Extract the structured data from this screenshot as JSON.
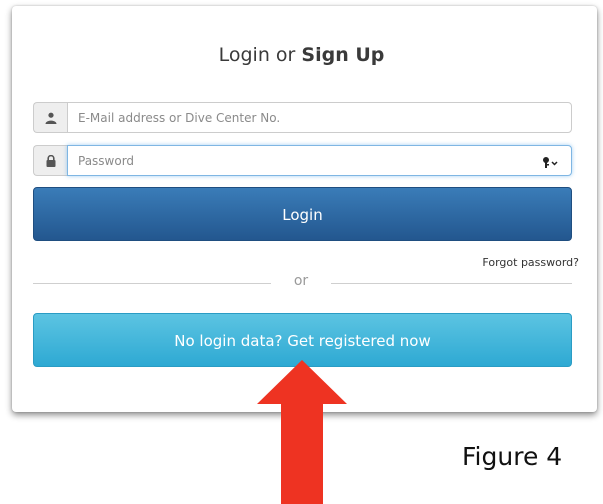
{
  "form": {
    "title_prefix": "Login or ",
    "title_bold": "Sign Up",
    "email": {
      "placeholder": "E-Mail address or Dive Center No.",
      "value": "",
      "icon": "user-icon"
    },
    "password": {
      "placeholder": "Password",
      "value": "",
      "icon": "lock-icon",
      "trailing_icon": "key-dropdown-icon"
    },
    "login_label": "Login",
    "forgot_label": "Forgot password?",
    "divider_label": "or",
    "register_label": "No login data? Get registered now"
  },
  "annotation": {
    "figure_label": "Figure 4",
    "arrow_color": "#ee3322",
    "arrow": "up-arrow-icon"
  },
  "colors": {
    "login_button": "#2c6aa3",
    "register_button": "#3db5dc",
    "focus_border": "#7fb6e3"
  }
}
